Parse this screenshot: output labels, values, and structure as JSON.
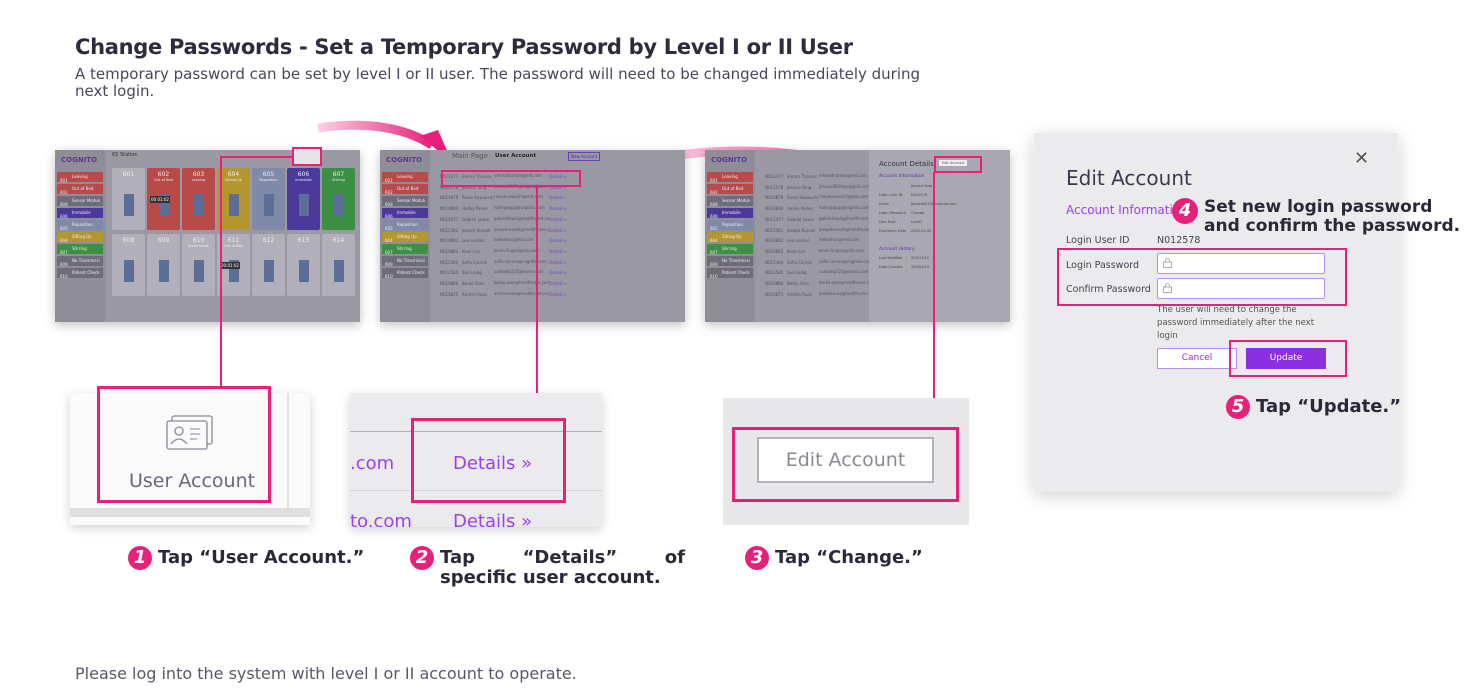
{
  "title": "Change Passwords - Set a Temporary Password by Level I or II User",
  "subtitle": "A temporary password can be set by level I or II user. The password will need to be changed immediately during next login.",
  "footer": "Please log into the system with level I or II account to operate.",
  "colors": {
    "highlight": "#e8207a",
    "accent": "#8c2fe0",
    "link": "#9b3ff0"
  },
  "screens": {
    "s1": {
      "logo": "COGNITO",
      "station": "6S Station",
      "sidebar": [
        {
          "no": "601",
          "label": "Leaving",
          "color": "#b84a4a"
        },
        {
          "no": "602",
          "label": "Out of Bed",
          "color": "#b84a4a"
        },
        {
          "no": "608",
          "label": "Sensor Module Disconnected",
          "color": "#6e6c78"
        },
        {
          "no": "606",
          "label": "Immobile",
          "color": "#4b3a9c"
        },
        {
          "no": "605",
          "label": "Reposition",
          "color": "#7f8aa8"
        },
        {
          "no": "604",
          "label": "Sitting Up",
          "color": "#b39630"
        },
        {
          "no": "607",
          "label": "Stirring",
          "color": "#3d8f45"
        },
        {
          "no": "609",
          "label": "No Transmission",
          "color": "#6e6c78"
        },
        {
          "no": "610",
          "label": "Patient Check-in",
          "color": "#6e6c78"
        }
      ],
      "cards": [
        {
          "no": "601",
          "status": "",
          "color": "#b1b0ba"
        },
        {
          "no": "602",
          "status": "Out of Bed",
          "color": "#b84a4a",
          "timer": "00:01:02"
        },
        {
          "no": "603",
          "status": "Leaving",
          "color": "#b84a4a"
        },
        {
          "no": "604",
          "status": "Sitting Up",
          "color": "#b39630"
        },
        {
          "no": "605",
          "status": "Reposition",
          "color": "#7f8aa8"
        },
        {
          "no": "606",
          "status": "Immobile",
          "color": "#4b3a9c"
        },
        {
          "no": "607",
          "status": "Stirring",
          "color": "#3d8f45"
        },
        {
          "no": "608",
          "status": "",
          "color": "#b1b0ba"
        },
        {
          "no": "609",
          "status": "",
          "color": "#b1b0ba"
        },
        {
          "no": "610",
          "status": "Nurse Mode",
          "color": "#b1b0ba"
        },
        {
          "no": "611",
          "status": "Out of Bed",
          "color": "#b1b0ba",
          "timer": "00:01:02"
        },
        {
          "no": "612",
          "status": "",
          "color": "#b1b0ba"
        },
        {
          "no": "613",
          "status": "",
          "color": "#b1b0ba"
        },
        {
          "no": "614",
          "status": "",
          "color": "#b1b0ba"
        }
      ]
    },
    "s2": {
      "main": "Main Page",
      "page": "User Account",
      "new_btn": "New Account",
      "rows": [
        {
          "id": "N012477",
          "name": "Emma Thomas",
          "email": "emmathomas@md.com"
        },
        {
          "id": "N012578",
          "name": "Jessica Yang",
          "email": "jessica0019@cognito.com"
        },
        {
          "id": "N010879",
          "name": "Rinko Kawauchi",
          "email": "rinkokawauchi@md.com"
        },
        {
          "id": "N010880",
          "name": "Hailey Parker",
          "email": "haileypppp@cognito.com"
        },
        {
          "id": "N012477",
          "name": "Gabriel Lewis",
          "email": "gabriellewis@healthcare.com"
        },
        {
          "id": "N012581",
          "name": "Joseph Russell",
          "email": "josephrussell@healthcare.com"
        },
        {
          "id": "N010882",
          "name": "Lee Lenhoc",
          "email": "leelenhoc@md.com"
        },
        {
          "id": "N010883",
          "name": "Kevin Lin",
          "email": "kevin.lin@cognito.com"
        },
        {
          "id": "N012484",
          "name": "Sofia Carson",
          "email": "sofia.carson@cognito.com"
        },
        {
          "id": "N012585",
          "name": "Sue Ladig",
          "email": "sueladig123@nurse.com"
        },
        {
          "id": "N010886",
          "name": "Berko Ozer",
          "email": "berko.ozer@healthcare.com"
        },
        {
          "id": "N010875",
          "name": "Andrés Ruos",
          "email": "andresruos@healthcare.com"
        }
      ],
      "details": "Details »"
    },
    "s3": {
      "panel_title": "Account Details",
      "edit_btn": "Edit Account",
      "section": "Account Information",
      "fields": [
        {
          "k": "",
          "v": "Jessica Yang"
        },
        {
          "k": "Login User ID",
          "v": "N012578"
        },
        {
          "k": "Email",
          "v": "jessica0019@cognito.com"
        },
        {
          "k": "Login Password",
          "v": "Change"
        },
        {
          "k": "User Role",
          "v": "Level2"
        },
        {
          "k": "Expiration Date",
          "v": "2022-03-30"
        }
      ],
      "history": "Account History",
      "history_fields": [
        {
          "k": "Last Modified",
          "v": "2021/3/12"
        },
        {
          "k": "Date Created",
          "v": "2020/8/10"
        }
      ]
    }
  },
  "crops": {
    "c1_label": "User Account",
    "c2_left": ".com",
    "c2_link": "Details »",
    "c2_left2": "to.com",
    "c2_link2": "Details »",
    "c3_button": "Edit Account"
  },
  "steps": [
    {
      "n": "1",
      "text": "Tap “User Account.”"
    },
    {
      "n": "2",
      "text": "Tap “Details” of specific user account."
    },
    {
      "n": "3",
      "text": "Tap “Change.”"
    },
    {
      "n": "4",
      "text": "Set new login password and confirm the password."
    },
    {
      "n": "5",
      "text": "Tap “Update.”"
    }
  ],
  "dialog": {
    "title": "Edit Account",
    "section": "Account Information",
    "user_id_label": "Login User ID",
    "user_id": "N012578",
    "password_label": "Login Password",
    "confirm_label": "Confirm Password",
    "password_value": "",
    "confirm_value": "",
    "note": "The user will need to change the password immediately after the next login",
    "cancel": "Cancel",
    "update": "Update"
  }
}
